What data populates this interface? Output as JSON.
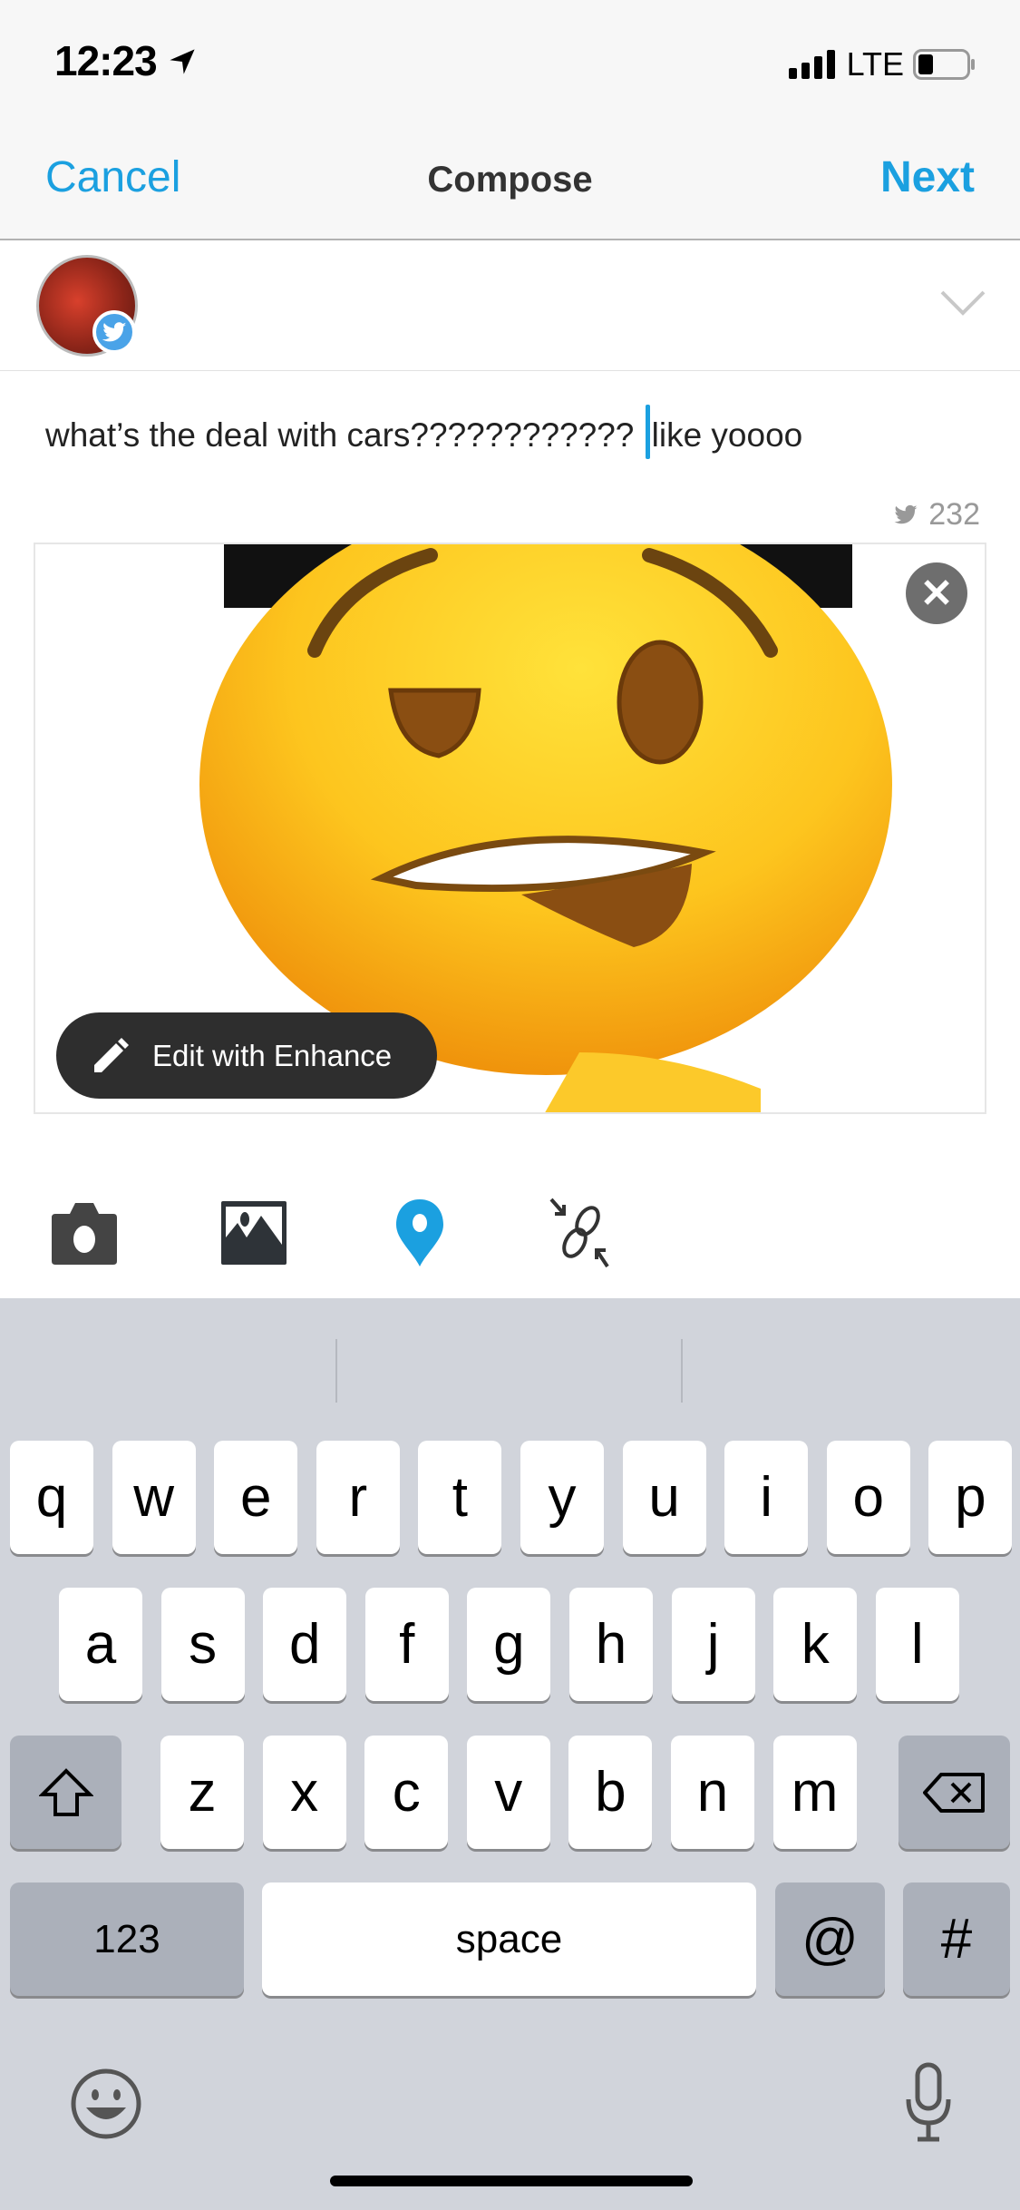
{
  "status_bar": {
    "time": "12:23",
    "network": "LTE",
    "icons": [
      "location-arrow-icon",
      "signal-icon",
      "battery-icon"
    ]
  },
  "nav": {
    "cancel": "Cancel",
    "title": "Compose",
    "next": "Next"
  },
  "compose": {
    "text_before_cursor": "what’s the deal with cars???????????? ",
    "text_after_cursor": "like yoooo",
    "char_count": "232",
    "account_icon": "twitter-bird-icon"
  },
  "media": {
    "edit_label": "Edit with Enhance",
    "close_icon": "close-icon",
    "edit_icon": "pencil-icon"
  },
  "toolbar": {
    "icons": [
      "camera-icon",
      "image-icon",
      "location-pin-icon",
      "link-icon"
    ],
    "accent": "#1ba0e0"
  },
  "keyboard": {
    "row1": [
      "q",
      "w",
      "e",
      "r",
      "t",
      "y",
      "u",
      "i",
      "o",
      "p"
    ],
    "row2": [
      "a",
      "s",
      "d",
      "f",
      "g",
      "h",
      "j",
      "k",
      "l"
    ],
    "row3": [
      "z",
      "x",
      "c",
      "v",
      "b",
      "n",
      "m"
    ],
    "numbers": "123",
    "space": "space",
    "at": "@",
    "hash": "#"
  },
  "colors": {
    "accent": "#1ba0e0",
    "keyboard_bg": "#d1d4db"
  }
}
